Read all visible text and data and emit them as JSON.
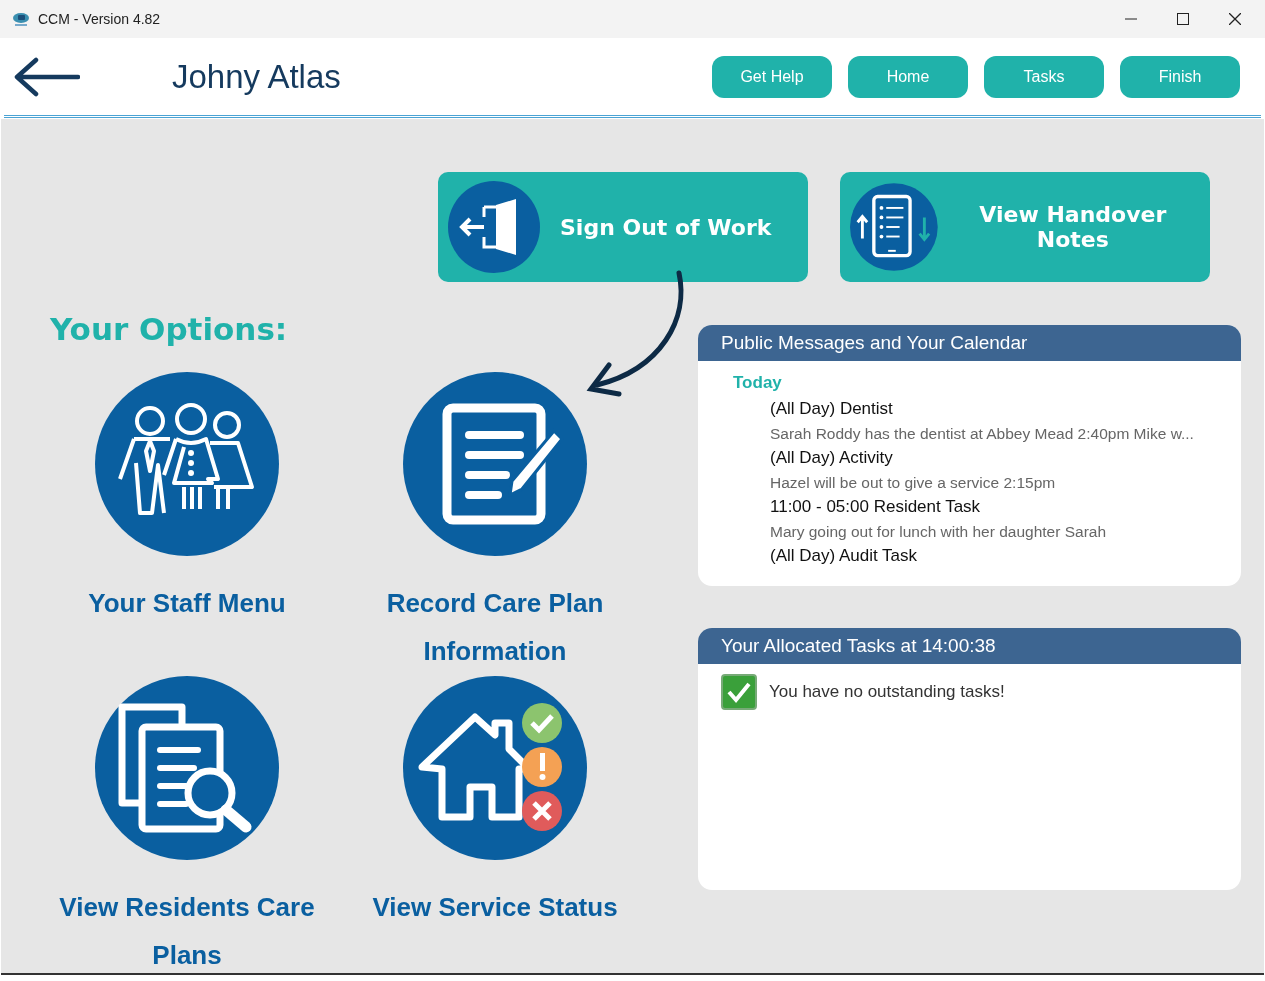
{
  "window": {
    "title": "CCM - Version 4.82"
  },
  "header": {
    "user_name": "Johny Atlas",
    "buttons": [
      "Get Help",
      "Home",
      "Tasks",
      "Finish"
    ]
  },
  "actions": [
    {
      "kind": "sign-out",
      "label": "Sign Out of Work"
    },
    {
      "kind": "handover",
      "label": "View Handover Notes"
    }
  ],
  "options_heading": "Your Options:",
  "options": [
    {
      "kind": "staff",
      "label": "Your Staff Menu"
    },
    {
      "kind": "record",
      "label": "Record Care Plan Information"
    },
    {
      "kind": "residents",
      "label": "View Residents Care Plans"
    },
    {
      "kind": "service",
      "label": "View Service Status"
    }
  ],
  "calendar": {
    "title": "Public Messages and Your Calendar",
    "day": "Today",
    "entries": [
      {
        "heading": "(All Day) Dentist",
        "detail": "Sarah Roddy has the dentist at Abbey Mead 2:40pm Mike w..."
      },
      {
        "heading": "(All Day) Activity",
        "detail": "Hazel will be out to give a service 2:15pm"
      },
      {
        "heading": "11:00 - 05:00 Resident Task",
        "detail": "Mary going out for lunch with her daughter Sarah"
      },
      {
        "heading": "(All Day) Audit Task"
      }
    ]
  },
  "tasks": {
    "title": "Your Allocated Tasks at 14:00:38",
    "message": "You have no outstanding tasks!"
  }
}
